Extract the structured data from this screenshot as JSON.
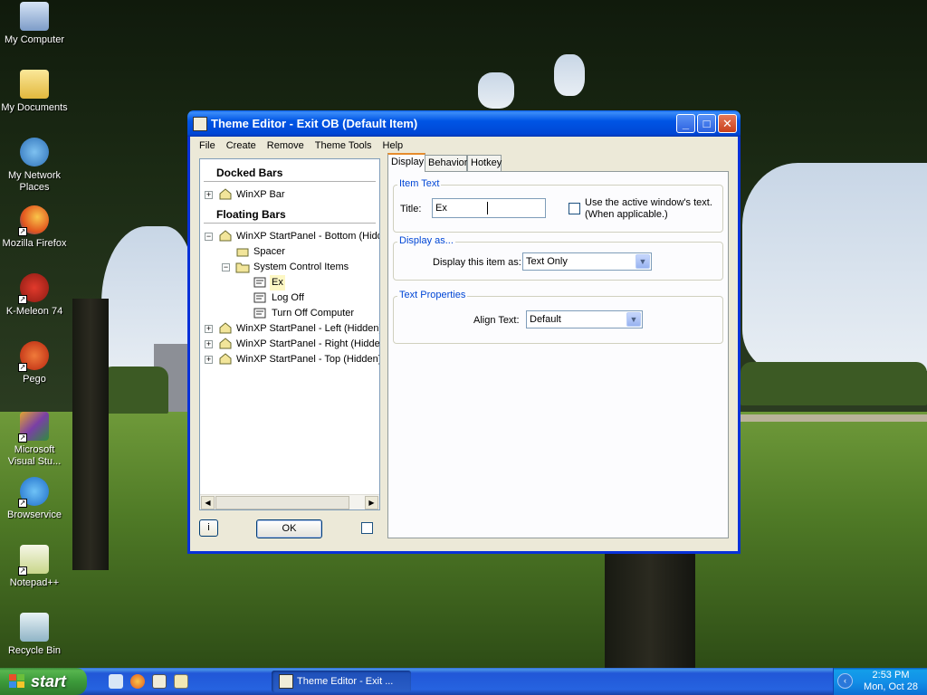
{
  "desktop": {
    "icons": [
      {
        "label": "My Computer",
        "icon": "my-computer-icon"
      },
      {
        "label": "My Documents",
        "icon": "my-documents-icon"
      },
      {
        "label": "My Network Places",
        "icon": "network-places-icon"
      },
      {
        "label": "Mozilla Firefox",
        "icon": "firefox-icon"
      },
      {
        "label": "K-Meleon 74",
        "icon": "kmeleon-icon"
      },
      {
        "label": "Pego",
        "icon": "pego-icon"
      },
      {
        "label": "Microsoft Visual Stu...",
        "icon": "visual-studio-icon"
      },
      {
        "label": "Browservice",
        "icon": "browservice-icon"
      },
      {
        "label": "Notepad++",
        "icon": "notepadpp-icon"
      },
      {
        "label": "Recycle Bin",
        "icon": "recycle-bin-icon"
      }
    ]
  },
  "window": {
    "title": "Theme Editor  -  Exit OB  (Default Item)",
    "controls": {
      "minimize": "_",
      "maximize": "□",
      "close": "✕"
    },
    "menu": [
      "File",
      "Create",
      "Remove",
      "Theme Tools",
      "Help"
    ]
  },
  "tree": {
    "docked_header": "Docked Bars",
    "floating_header": "Floating Bars",
    "docked": [
      {
        "label": "WinXP Bar",
        "expander": "+"
      }
    ],
    "floating": [
      {
        "label": "WinXP StartPanel - Bottom (Hidden)",
        "expander": "−"
      },
      {
        "label": "Spacer"
      },
      {
        "label": "System Control Items",
        "expander": "−"
      },
      {
        "label": "Ex"
      },
      {
        "label": "Log Off"
      },
      {
        "label": "Turn Off Computer"
      },
      {
        "label": "WinXP StartPanel - Left (Hidden)",
        "expander": "+"
      },
      {
        "label": "WinXP StartPanel - Right (Hidden)",
        "expander": "+"
      },
      {
        "label": "WinXP StartPanel - Top (Hidden)",
        "expander": "+"
      }
    ],
    "scroll_left": "◀",
    "scroll_right": "▶"
  },
  "footer": {
    "info_label": "i",
    "ok_label": "OK"
  },
  "tabs": [
    "Display",
    "Behavior",
    "Hotkey"
  ],
  "display": {
    "item_text_group": "Item Text",
    "title_label": "Title:",
    "title_value": "Ex",
    "use_active_label_line1": "Use the active window's text.",
    "use_active_label_line2": "(When applicable.)",
    "display_as_group": "Display as...",
    "display_item_label": "Display this item as:",
    "display_item_value": "Text Only",
    "text_properties_group": "Text Properties",
    "align_label": "Align Text:",
    "align_value": "Default",
    "dropdown_glyph": "▼"
  },
  "taskbar": {
    "start_label": "start",
    "task_button": "Theme Editor  -  Exit ...",
    "tray_arrow": "‹",
    "time": "2:53 PM",
    "date": "Mon, Oct 28"
  }
}
